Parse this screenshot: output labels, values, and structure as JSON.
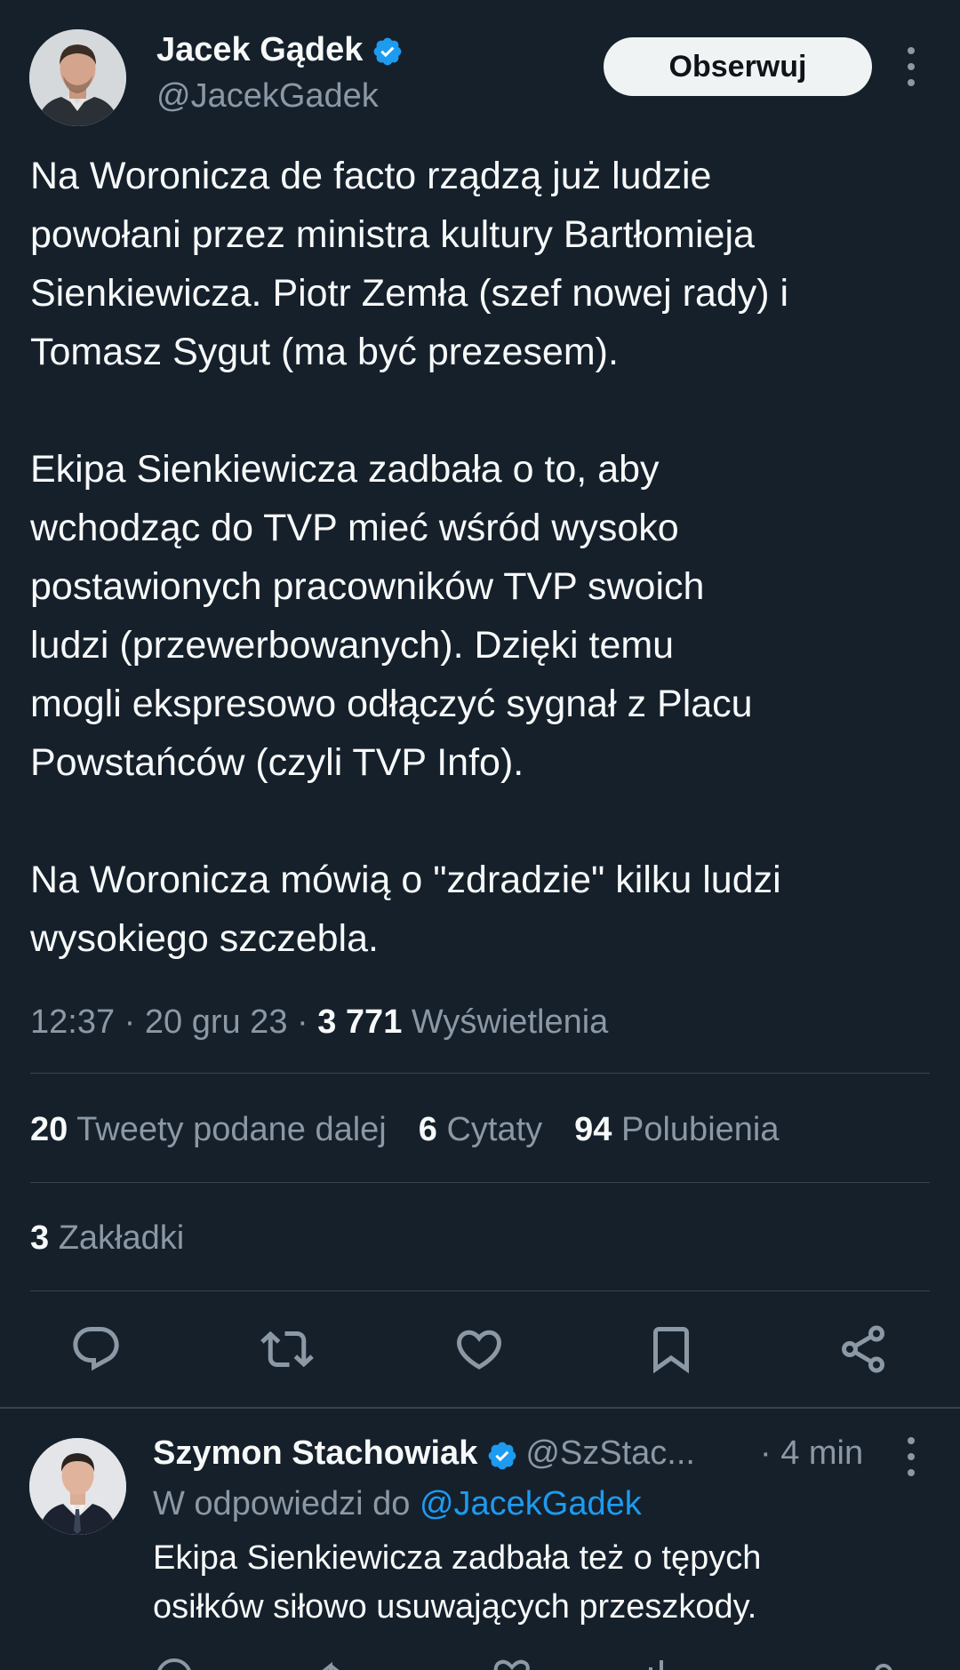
{
  "main_tweet": {
    "author_name": "Jacek Gądek",
    "handle": "@JacekGadek",
    "follow_label": "Obserwuj",
    "text_paragraphs": [
      [
        "Na Woronicza de facto rządzą już ludzie",
        "powołani przez ministra kultury Bartłomieja",
        "Sienkiewicza. Piotr Zemła (szef nowej rady) i",
        "Tomasz Sygut (ma być prezesem)."
      ],
      [
        "Ekipa Sienkiewicza zadbała o to, aby",
        "wchodząc do TVP mieć wśród wysoko",
        "postawionych pracowników TVP swoich",
        "ludzi (przewerbowanych). Dzięki temu",
        "mogli ekspresowo odłączyć sygnał z Placu",
        "Powstańców (czyli TVP Info)."
      ],
      [
        "Na Woronicza mówią o \"zdradzie\" kilku ludzi",
        "wysokiego szczebla."
      ]
    ],
    "time": "12:37",
    "date": "20 gru 23",
    "views_count": "3 771",
    "views_label": "Wyświetlenia",
    "separator": "·",
    "stats": {
      "retweets_count": "20",
      "retweets_label": "Tweety podane dalej",
      "quotes_count": "6",
      "quotes_label": "Cytaty",
      "likes_count": "94",
      "likes_label": "Polubienia",
      "bookmarks_count": "3",
      "bookmarks_label": "Zakładki"
    },
    "actions": [
      "reply-icon",
      "retweet-icon",
      "like-icon",
      "bookmark-icon",
      "share-icon"
    ]
  },
  "reply": {
    "author_name": "Szymon Stachowiak",
    "handle": "@SzStac...",
    "time": "· 4 min",
    "replying_to_label": "W odpowiedzi do",
    "replying_to_handle": "@JacekGadek",
    "text_lines": [
      "Ekipa Sienkiewicza zadbała też o tępych",
      "osiłków siłowo usuwających przeszkody."
    ]
  },
  "colors": {
    "background": "#15202b",
    "text_primary": "#f7f9f9",
    "text_secondary": "#8b98a5",
    "accent": "#1d9bf0",
    "divider": "#38444d",
    "follow_bg": "#eff3f4"
  }
}
